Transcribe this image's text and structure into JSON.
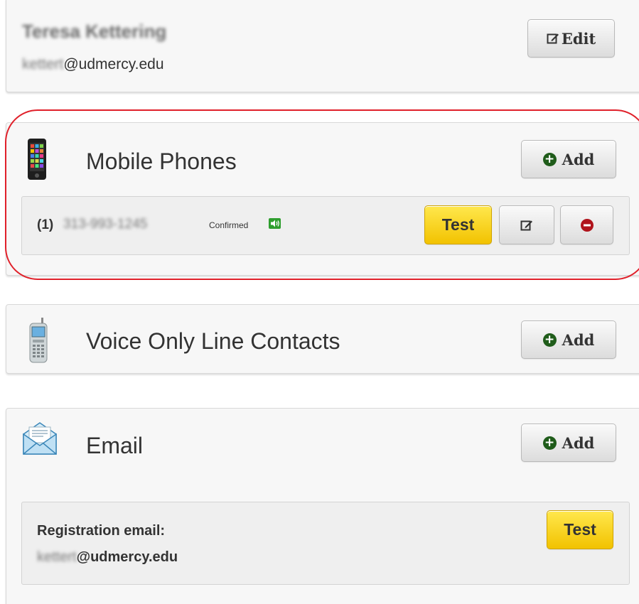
{
  "profile": {
    "name": "Teresa Kettering",
    "email_user": "kettert",
    "email_domain": "@udmercy.edu",
    "edit_label": "Edit"
  },
  "mobile": {
    "title": "Mobile Phones",
    "add_label": "Add",
    "entry": {
      "index": "(1)",
      "number": "313-993-1245",
      "status": "Confirmed",
      "test_label": "Test"
    }
  },
  "voice": {
    "title": "Voice Only Line Contacts",
    "add_label": "Add"
  },
  "email": {
    "title": "Email",
    "add_label": "Add",
    "registration_label": "Registration email:",
    "address_user": "kettert",
    "address_domain": "@udmercy.edu",
    "test_label": "Test"
  },
  "colors": {
    "highlight_ring": "#e0202a",
    "test_button": "#f8d81c",
    "add_icon": "#1f5c1a",
    "remove_icon": "#b0141c",
    "confirmed_badge": "#2e9e2e"
  },
  "icons": [
    "edit-icon",
    "smartphone-icon",
    "plus-circle-icon",
    "speaker-icon",
    "remove-icon",
    "feature-phone-icon",
    "envelope-icon"
  ]
}
